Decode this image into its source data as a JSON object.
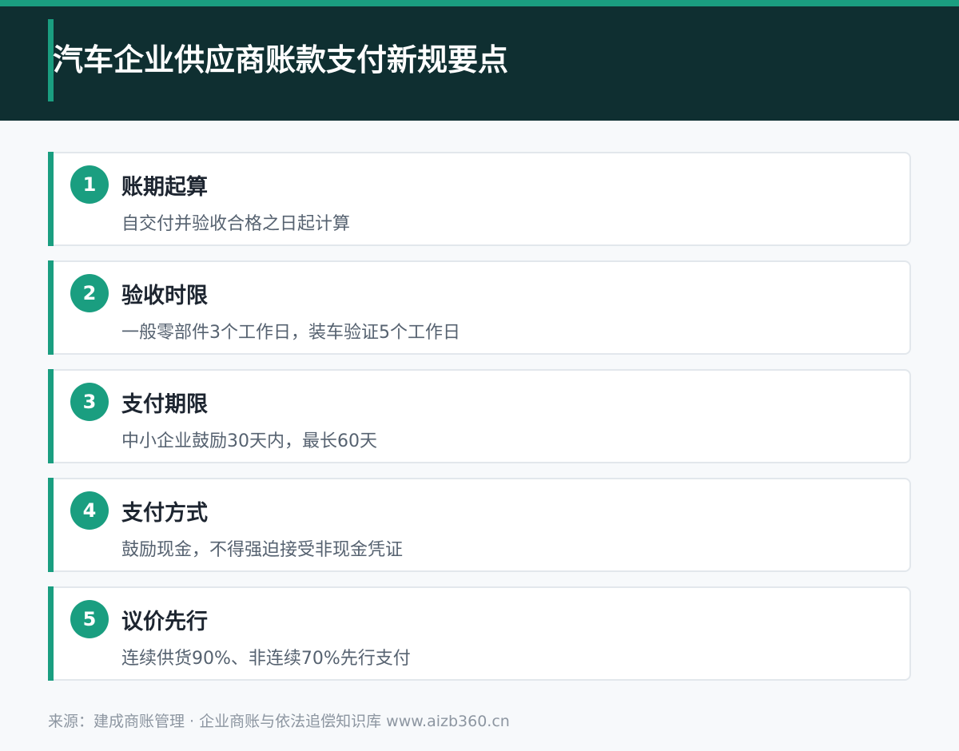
{
  "header": {
    "title": "汽车企业供应商账款支付新规要点"
  },
  "items": [
    {
      "num": "1",
      "title": "账期起算",
      "desc": "自交付并验收合格之日起计算"
    },
    {
      "num": "2",
      "title": "验收时限",
      "desc": "一般零部件3个工作日，装车验证5个工作日"
    },
    {
      "num": "3",
      "title": "支付期限",
      "desc": "中小企业鼓励30天内，最长60天"
    },
    {
      "num": "4",
      "title": "支付方式",
      "desc": "鼓励现金，不得强迫接受非现金凭证"
    },
    {
      "num": "5",
      "title": "议价先行",
      "desc": "连续供货90%、非连续70%先行支付"
    }
  ],
  "footer": {
    "source": "来源：建成商账管理 · 企业商账与依法追偿知识库  www.aizb360.cn"
  },
  "colors": {
    "header_bg": "#0f2f31",
    "accent": "#1a9e80",
    "page_bg": "#f7f9fb",
    "card_border": "#e2e7ec"
  }
}
